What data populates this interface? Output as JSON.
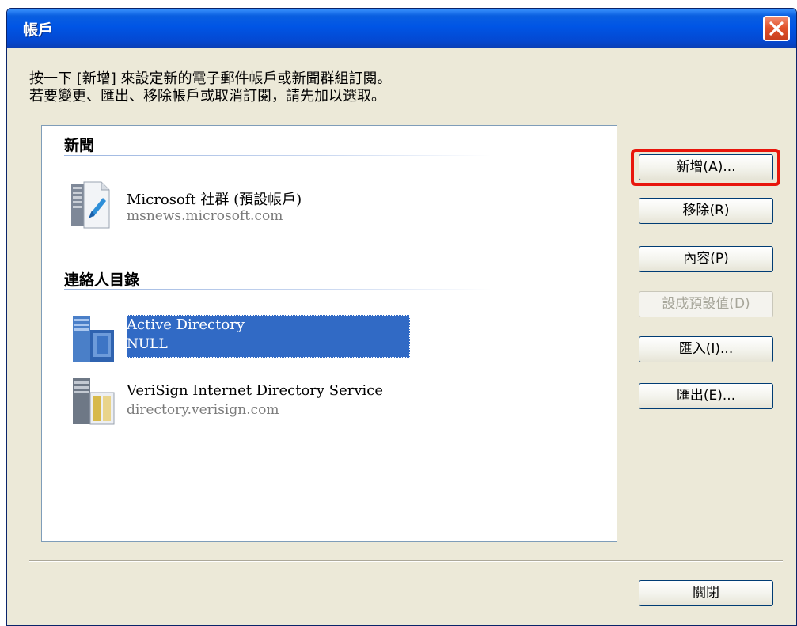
{
  "window": {
    "title": "帳戶",
    "close_icon": "close-x-icon"
  },
  "instruction": {
    "line1": "按一下 [新增] 來設定新的電子郵件帳戶或新聞群組訂閱。",
    "line2": "若要變更、匯出、移除帳戶或取消訂閱，請先加以選取。"
  },
  "list": {
    "groups": [
      {
        "header": "新聞",
        "items": [
          {
            "name": "Microsoft 社群 (預設帳戶)",
            "detail": "msnews.microsoft.com",
            "icon": "news-server-icon",
            "selected": false
          }
        ]
      },
      {
        "header": "連絡人目錄",
        "items": [
          {
            "name": "Active Directory",
            "detail": "NULL",
            "icon": "directory-server-icon",
            "selected": true
          },
          {
            "name": "VeriSign Internet Directory Service",
            "detail": "directory.verisign.com",
            "icon": "directory-service-icon",
            "selected": false
          }
        ]
      }
    ]
  },
  "buttons": {
    "add": "新增(A)...",
    "remove": "移除(R)",
    "properties": "內容(P)",
    "set_default": "設成預設值(D)",
    "import": "匯入(I)...",
    "export": "匯出(E)...",
    "close": "關閉"
  },
  "colors": {
    "titlebar": "#0055E5",
    "dialog_bg": "#ECE9D8",
    "selection": "#316AC5",
    "highlight_ring": "#E8160C",
    "close_button": "#E2532C"
  }
}
